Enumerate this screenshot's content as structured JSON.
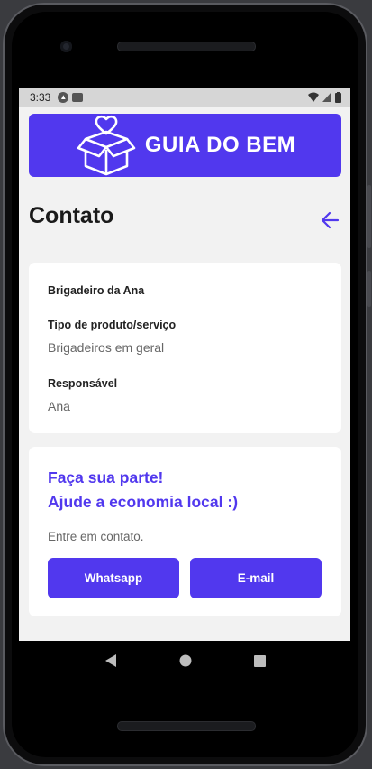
{
  "status_bar": {
    "time": "3:33"
  },
  "header": {
    "app_title": "GUIA DO BEM"
  },
  "page": {
    "title": "Contato"
  },
  "details": {
    "business_name": "Brigadeiro da Ana",
    "product_label": "Tipo de produto/serviço",
    "product_value": "Brigadeiros em geral",
    "owner_label": "Responsável",
    "owner_value": "Ana"
  },
  "contact": {
    "headline_1": "Faça sua parte!",
    "headline_2": "Ajude a economia local :)",
    "subtitle": "Entre em contato.",
    "whatsapp_label": "Whatsapp",
    "email_label": "E-mail"
  },
  "colors": {
    "accent": "#5138ee",
    "background": "#f2f2f2"
  }
}
